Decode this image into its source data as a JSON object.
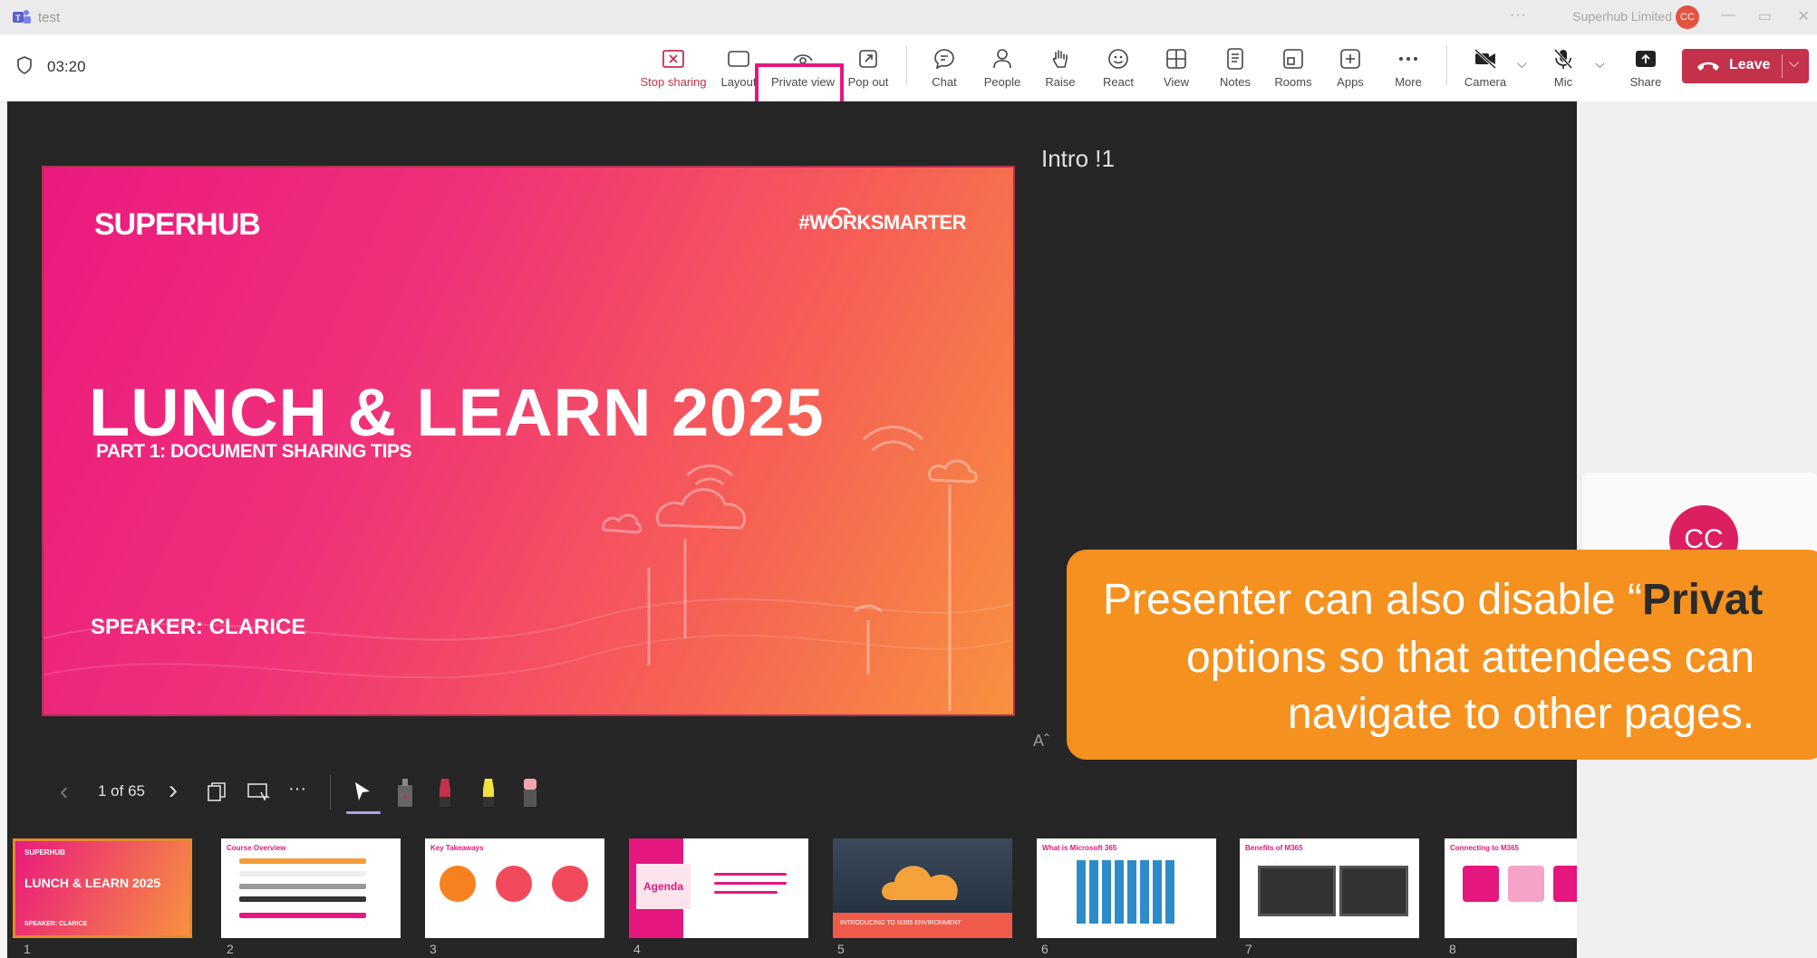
{
  "window": {
    "app_name": "test",
    "org_name": "Superhub Limited",
    "org_avatar": "CC",
    "more_dots": "···",
    "minimize": "—",
    "restore": "▭",
    "close": "✕"
  },
  "toolbar": {
    "timer": "03:20",
    "stop_sharing": "Stop sharing",
    "layout": "Layout",
    "private_view": "Private view",
    "pop_out": "Pop out",
    "chat": "Chat",
    "people": "People",
    "raise": "Raise",
    "react": "React",
    "view": "View",
    "notes": "Notes",
    "rooms": "Rooms",
    "apps": "Apps",
    "more": "More",
    "camera": "Camera",
    "mic": "Mic",
    "share": "Share",
    "leave": "Leave"
  },
  "slide": {
    "brand_left": "SUPERHUB",
    "brand_right": "#WORKSMARTER",
    "title": "LUNCH & LEARN 2025",
    "subtitle": "PART 1: DOCUMENT SHARING TIPS",
    "speaker": "SPEAKER: CLARICE"
  },
  "notes": {
    "title": "Intro !1",
    "font_adjust": "Aˆ"
  },
  "attendee": {
    "avatar_initials": "CC"
  },
  "callout": {
    "line1_prefix": "Presenter can also disable “",
    "line1_bold": "Privat",
    "line2": "options so that attendees can",
    "line3": "navigate to other pages."
  },
  "slide_controls": {
    "prev": "‹",
    "pager": "1 of 65",
    "next": "›",
    "more": "···"
  },
  "thumbnails": {
    "items": [
      {
        "num": "1",
        "title": "LUNCH & LEARN 2025"
      },
      {
        "num": "2",
        "title": "Course Overview"
      },
      {
        "num": "3",
        "title": "Key Takeaways"
      },
      {
        "num": "4",
        "title": "Agenda"
      },
      {
        "num": "5",
        "title": "INTRODUCING TO M365 ENVIRONMENT"
      },
      {
        "num": "6",
        "title": "What is Microsoft 365"
      },
      {
        "num": "7",
        "title": "Benefits of M365"
      },
      {
        "num": "8",
        "title": "Connecting to M365"
      }
    ]
  },
  "colors": {
    "accent_pink": "#e5177f",
    "leave_red": "#c4314b",
    "callout_orange": "#f5911f"
  }
}
